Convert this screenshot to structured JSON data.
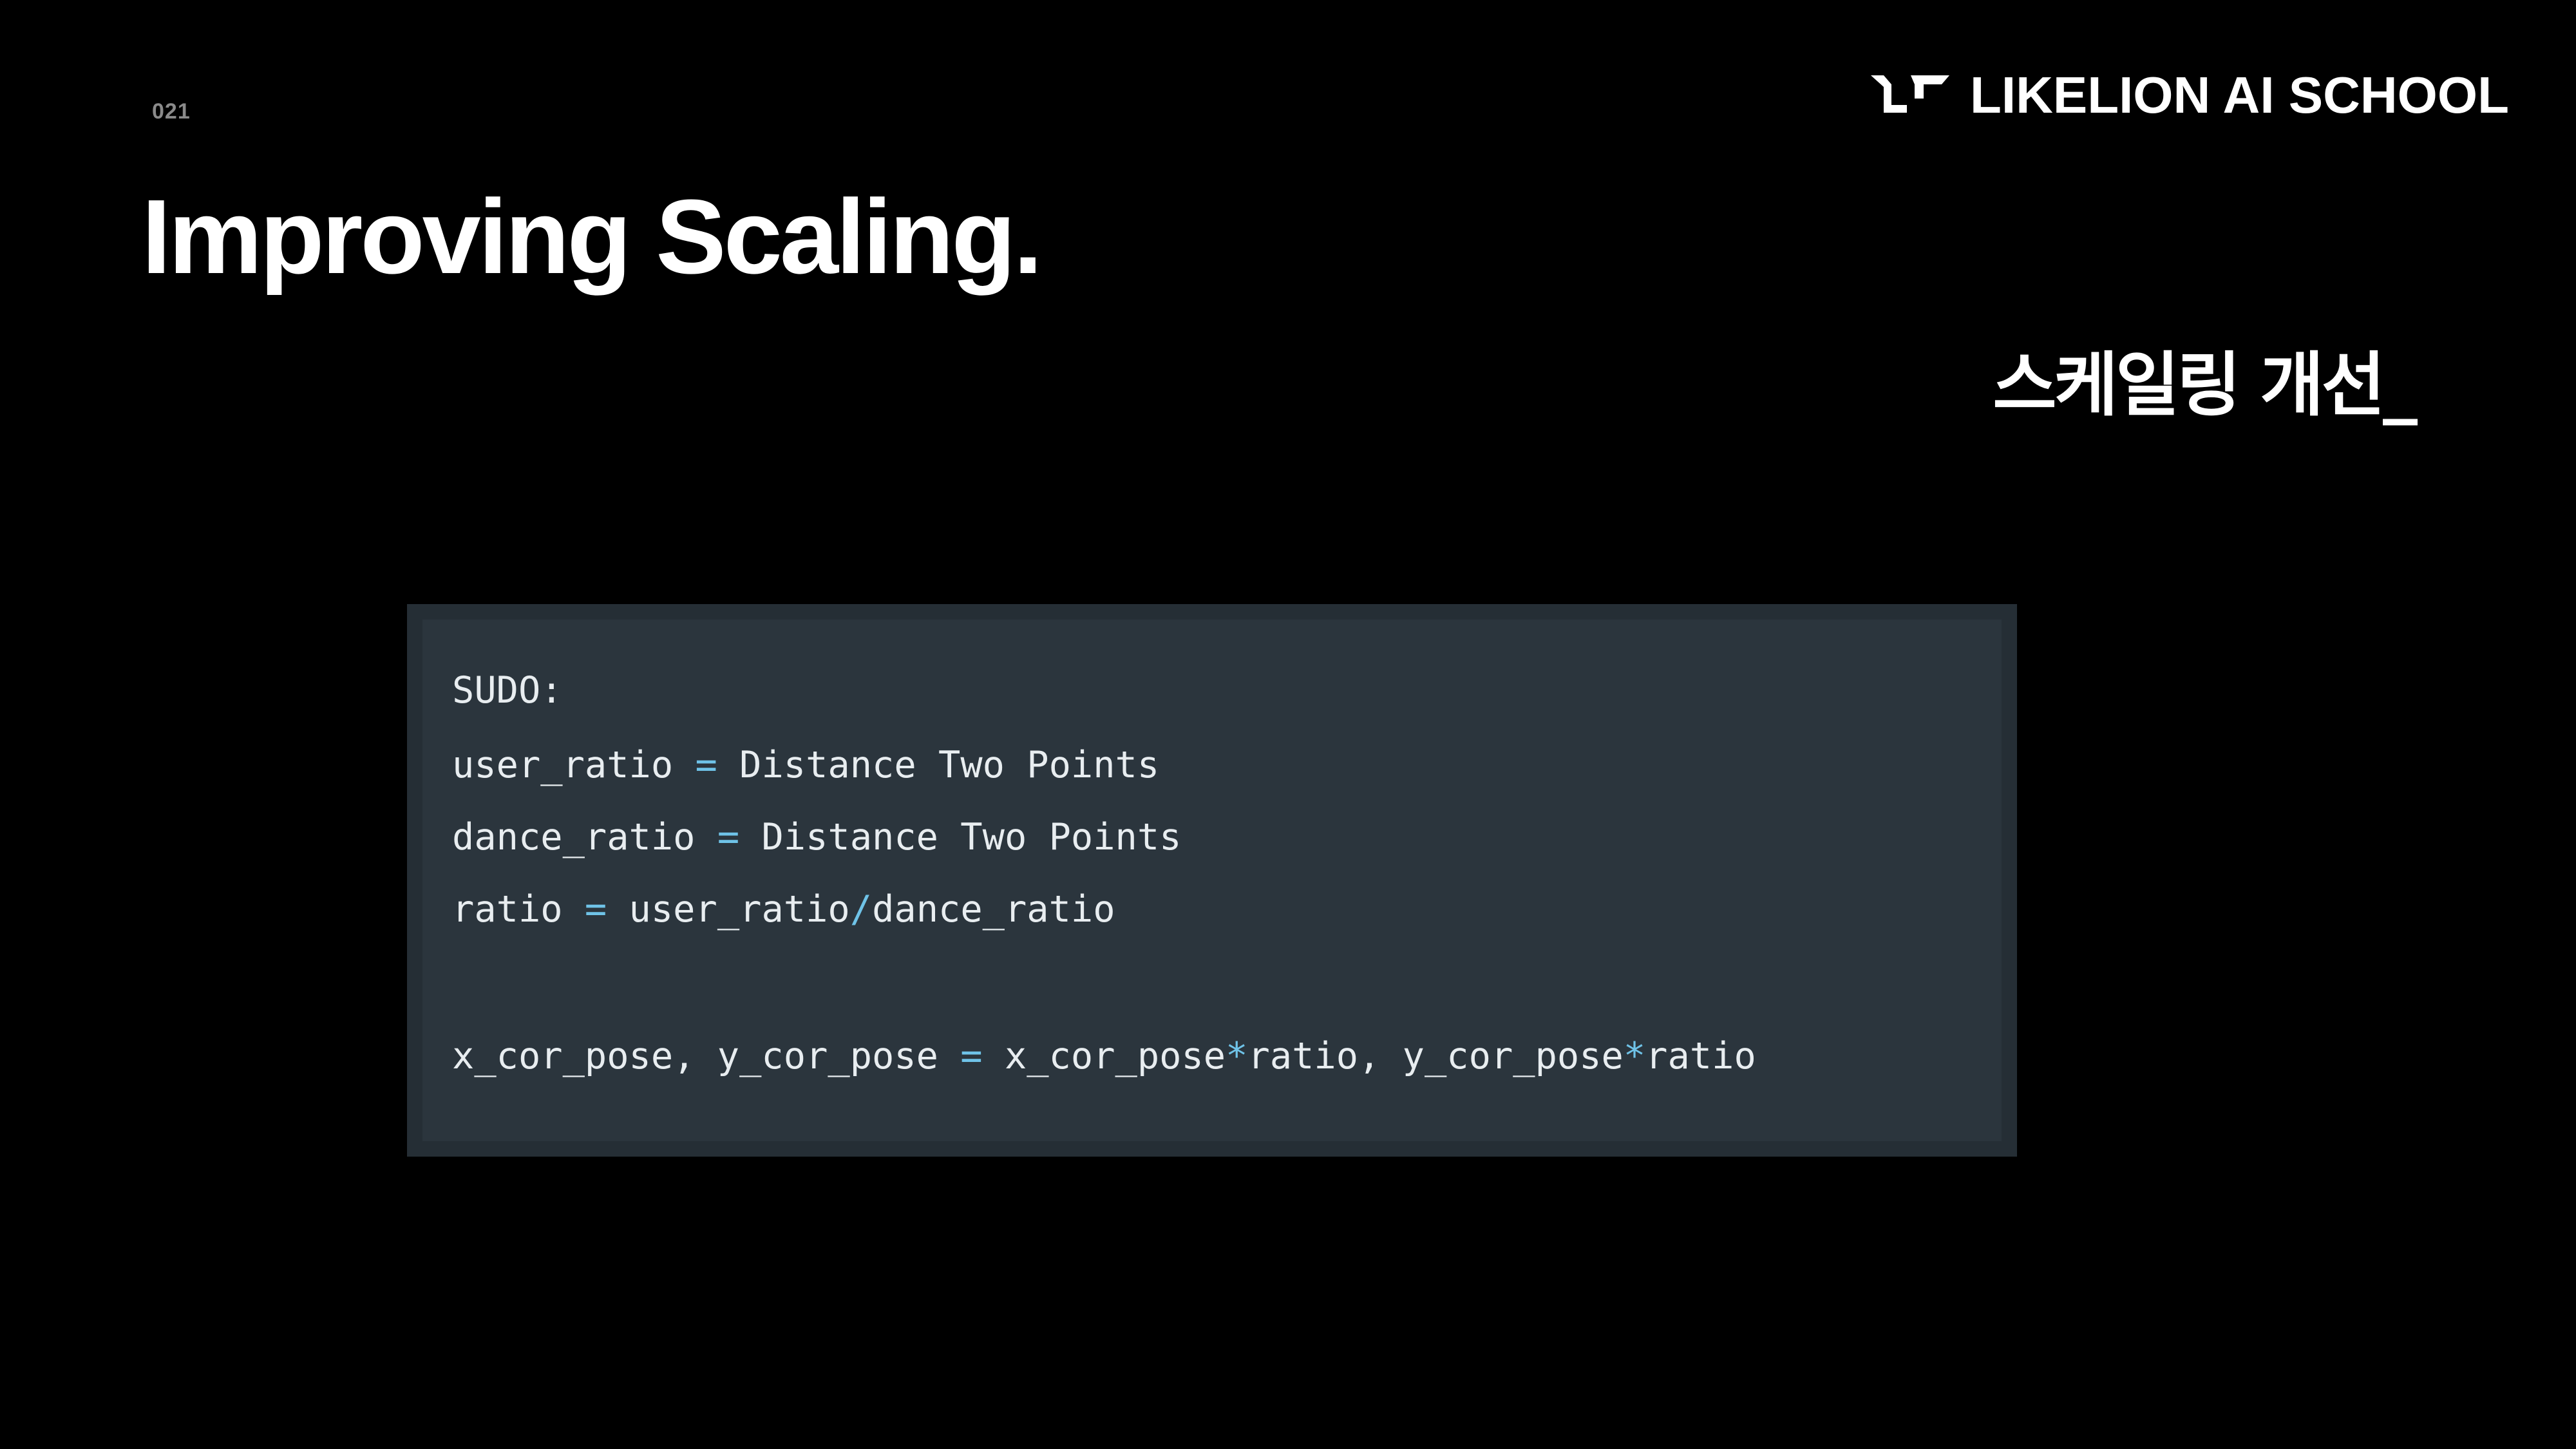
{
  "slide": {
    "number": "021",
    "title": "Improving Scaling.",
    "subtitle": "스케일링 개선_"
  },
  "brand": {
    "name": "LIKELION AI SCHOOL",
    "icon": "likelion-logo-mark",
    "color": "#ffffff"
  },
  "code": {
    "background": "#2b353d",
    "operator_color": "#6fc3e8",
    "lines": [
      {
        "pre": "SUDO:",
        "op": "",
        "post": "",
        "op2": "",
        "post2": "",
        "op3": "",
        "post3": ""
      },
      {
        "pre": "user_ratio ",
        "op": "=",
        "post": " Distance Two Points",
        "op2": "",
        "post2": "",
        "op3": "",
        "post3": ""
      },
      {
        "pre": "dance_ratio ",
        "op": "=",
        "post": " Distance Two Points",
        "op2": "",
        "post2": "",
        "op3": "",
        "post3": ""
      },
      {
        "pre": "ratio ",
        "op": "=",
        "post": " user_ratio",
        "op2": "/",
        "post2": "dance_ratio",
        "op3": "",
        "post3": ""
      },
      {
        "pre": "x_cor_pose, y_cor_pose ",
        "op": "=",
        "post": " x_cor_pose",
        "op2": "*",
        "post2": "ratio, y_cor_pose",
        "op3": "*",
        "post3": "ratio"
      }
    ]
  }
}
